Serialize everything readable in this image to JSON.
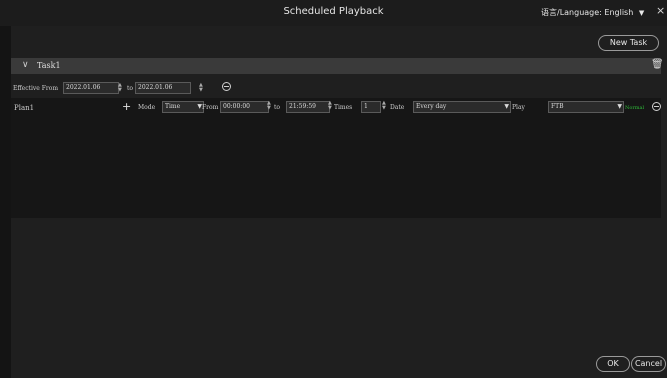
{
  "window": {
    "title": "Scheduled Playback",
    "close": "×"
  },
  "language": {
    "label": "语言/Language: English",
    "caret": "▼"
  },
  "toolbar": {
    "new_task": "New Task"
  },
  "task": {
    "name": "Task1",
    "chevron": "∨",
    "delete_icon": "trash-icon"
  },
  "effective": {
    "label": "Effective From",
    "from": "2022.01.06",
    "to_label": "to",
    "to": "2022.01.06"
  },
  "plan": {
    "name": "Plan1",
    "add": "+",
    "mode_label": "Mode",
    "mode_value": "Time",
    "from_label": "From",
    "from_time": "00:00:00",
    "to_label": "to",
    "to_time": "21:59:59",
    "times_label": "Times",
    "times_value": "1",
    "date_label": "Date",
    "date_value": "Every day",
    "play_label": "Play",
    "play_value": "FTB",
    "status": "Normal"
  },
  "footer": {
    "ok": "OK",
    "cancel": "Cancel"
  },
  "colors": {
    "status_green": "#2fbf3a",
    "background": "#141414"
  }
}
